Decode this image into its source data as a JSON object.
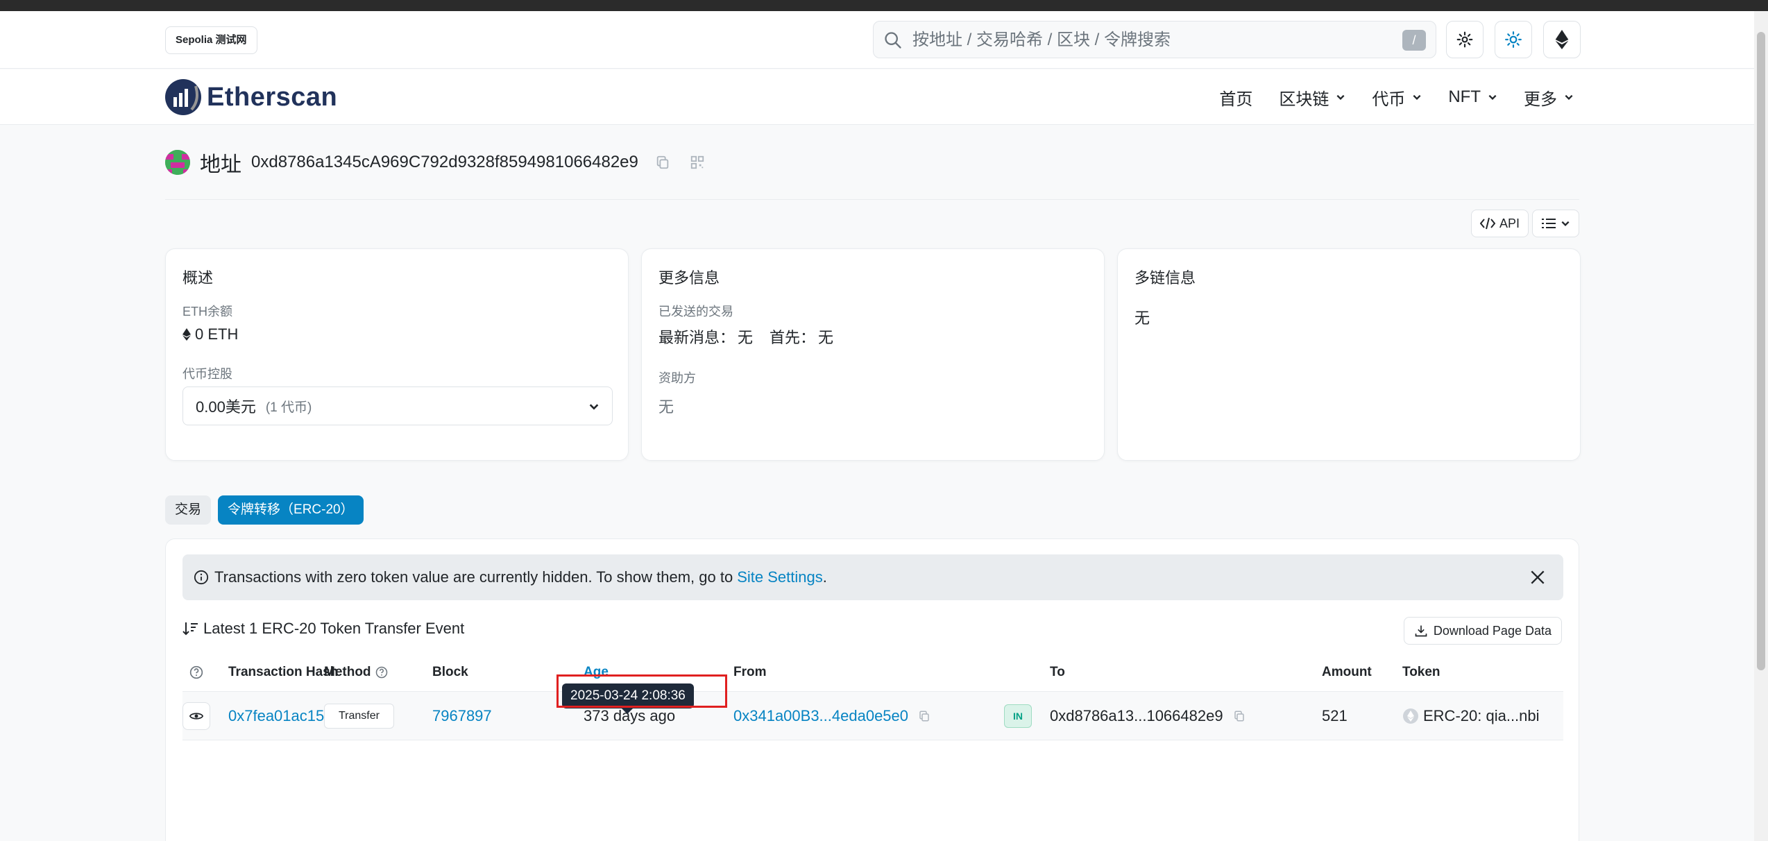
{
  "network_badge": "Sepolia 测试网",
  "search": {
    "placeholder": "按地址 / 交易哈希 / 区块 / 令牌搜索",
    "shortcut": "/"
  },
  "logo": {
    "text": "Etherscan"
  },
  "nav": {
    "items": [
      "首页",
      "区块链",
      "代币",
      "NFT",
      "更多"
    ]
  },
  "address": {
    "label": "地址",
    "value": "0xd8786a1345cA969C792d9328f8594981066482e9"
  },
  "toolbar": {
    "api_label": "API"
  },
  "overview": {
    "title": "概述",
    "eth_balance_label": "ETH余额",
    "eth_balance": "0 ETH",
    "holdings_label": "代币控股",
    "holdings_value": "0.00美元",
    "holdings_count": "(1 代币)"
  },
  "more_info": {
    "title": "更多信息",
    "sent_label": "已发送的交易",
    "latest_label": "最新消息：",
    "latest_value": "无",
    "first_label": "首先：",
    "first_value": "无",
    "funded_label": "资助方",
    "funded_value": "无"
  },
  "multichain": {
    "title": "多链信息",
    "value": "无"
  },
  "tabs": [
    {
      "label": "交易"
    },
    {
      "label": "令牌转移（ERC-20）"
    }
  ],
  "alert": {
    "text": "Transactions with zero token value are currently hidden. To show them, go to",
    "link": "Site Settings",
    "suffix": "."
  },
  "summary": {
    "text": "Latest 1 ERC-20 Token Transfer Event"
  },
  "download_label": "Download Page Data",
  "table": {
    "headers": {
      "hash": "Transaction Hash",
      "method": "Method",
      "block": "Block",
      "age": "Age",
      "from": "From",
      "to": "To",
      "amount": "Amount",
      "token": "Token"
    },
    "rows": [
      {
        "hash": "0x7fea01ac15c...",
        "method": "Transfer",
        "block": "7967897",
        "age": "373 days ago",
        "from": "0x341a00B3...4eda0e5e0",
        "direction": "IN",
        "to": "0xd8786a13...1066482e9",
        "amount": "521",
        "token": "ERC-20: qia...nbi"
      }
    ]
  },
  "tooltip": {
    "text": "2025-03-24 2:08:36"
  },
  "colors": {
    "accent": "#0784c3",
    "brand_dark": "#21325b",
    "in_badge": "#00a186",
    "highlight": "#e02020"
  }
}
